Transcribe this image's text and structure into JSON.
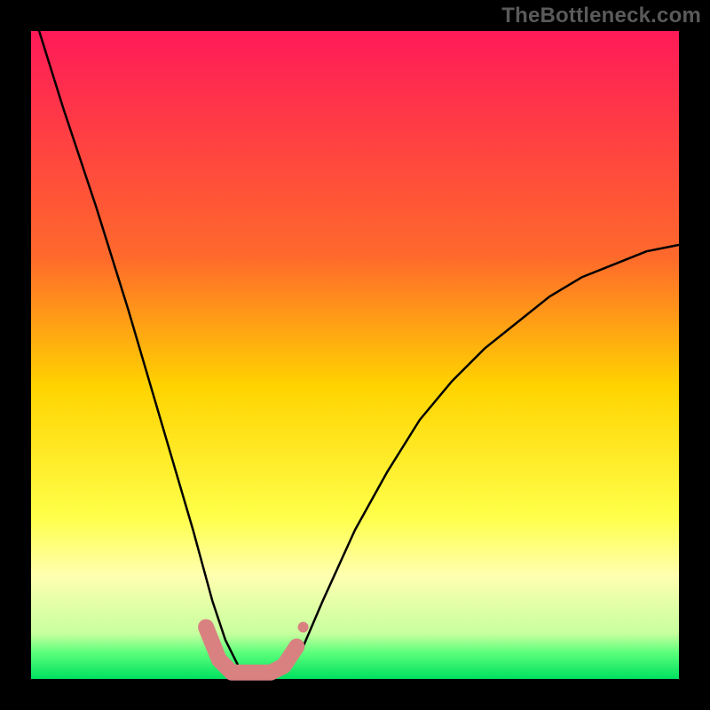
{
  "watermark": "TheBottleneck.com",
  "chart_data": {
    "type": "line",
    "title": "",
    "xlabel": "",
    "ylabel": "",
    "xlim": [
      0,
      100
    ],
    "ylim": [
      0,
      100
    ],
    "grid": false,
    "legend": false,
    "background_gradient": [
      {
        "stop": 0,
        "color": "#ff1a58"
      },
      {
        "stop": 0.35,
        "color": "#ff6a2b"
      },
      {
        "stop": 0.55,
        "color": "#ffd400"
      },
      {
        "stop": 0.75,
        "color": "#ffff4a"
      },
      {
        "stop": 0.84,
        "color": "#ffffb0"
      },
      {
        "stop": 0.93,
        "color": "#c7ff9e"
      },
      {
        "stop": 0.96,
        "color": "#5aff7a"
      },
      {
        "stop": 1.0,
        "color": "#00e060"
      }
    ],
    "series": [
      {
        "name": "bottleneck-curve",
        "stroke": "#000000",
        "x": [
          0,
          5,
          10,
          15,
          20,
          25,
          28,
          30,
          32,
          34,
          36,
          38,
          40,
          42,
          45,
          50,
          55,
          60,
          65,
          70,
          75,
          80,
          85,
          90,
          95,
          100
        ],
        "values": [
          104,
          88,
          73,
          57,
          40,
          23,
          12,
          6,
          2,
          1,
          1,
          1,
          2,
          5,
          12,
          23,
          32,
          40,
          46,
          51,
          55,
          59,
          62,
          64,
          66,
          67
        ]
      },
      {
        "name": "optimal-region",
        "stroke": "#d98181",
        "stroke_width": 18,
        "linecap": "round",
        "x": [
          27,
          29,
          31,
          33,
          35,
          37,
          39,
          41
        ],
        "values": [
          8,
          3,
          1,
          1,
          1,
          1,
          2,
          5
        ]
      }
    ],
    "annotations": [
      {
        "name": "optimal-dot",
        "x": 42,
        "y": 8,
        "r": 6,
        "color": "#d98181"
      }
    ]
  }
}
